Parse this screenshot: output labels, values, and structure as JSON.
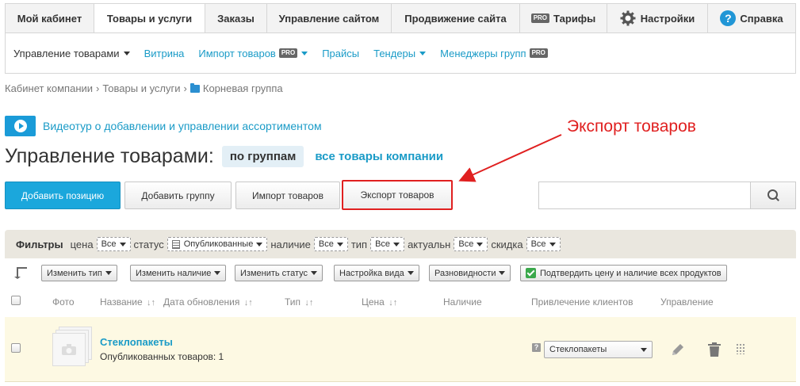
{
  "tabs": [
    {
      "label": "Мой кабинет"
    },
    {
      "label": "Товары и услуги"
    },
    {
      "label": "Заказы"
    },
    {
      "label": "Управление сайтом"
    },
    {
      "label": "Продвижение сайта"
    },
    {
      "label": "Тарифы",
      "badge": "PRO"
    },
    {
      "label": "Настройки",
      "icon": "gear-icon"
    },
    {
      "label": "Справка",
      "icon": "help-icon"
    }
  ],
  "active_tab": "Товары и услуги",
  "submenu": {
    "items": [
      {
        "label": "Управление товарами"
      },
      {
        "label": "Витрина"
      },
      {
        "label": "Импорт товаров",
        "badge": "PRO"
      },
      {
        "label": "Прайсы"
      },
      {
        "label": "Тендеры"
      },
      {
        "label": "Менеджеры групп",
        "badge": "PRO"
      }
    ]
  },
  "breadcrumb": {
    "items": [
      "Кабинет компании",
      "Товары и услуги",
      "Корневая группа"
    ],
    "separator": "›"
  },
  "video": {
    "label": "Видеотур о добавлении и управлении ассортиментом",
    "icon": "play-icon"
  },
  "annotation": {
    "text": "Экспорт товаров",
    "color": "#e02020"
  },
  "title": {
    "text": "Управление товарами:",
    "view_active": "по группам",
    "view_link": "все товары компании"
  },
  "buttons": {
    "add_position": "Добавить позицию",
    "add_group": "Добавить группу",
    "import": "Импорт товаров",
    "export": "Экспорт товаров"
  },
  "search": {
    "placeholder": "",
    "icon": "search-icon"
  },
  "filters": {
    "label": "Фильтры",
    "items": [
      {
        "name": "цена",
        "value": "Все"
      },
      {
        "name": "статус",
        "value": "Опубликованные"
      },
      {
        "name": "наличие",
        "value": "Все"
      },
      {
        "name": "тип",
        "value": "Все"
      },
      {
        "name": "актуальн",
        "value": "Все"
      },
      {
        "name": "скидка",
        "value": "Все"
      }
    ]
  },
  "actions": {
    "change_type": "Изменить тип",
    "change_availability": "Изменить наличие",
    "change_status": "Изменить статус",
    "view_settings": "Настройка вида",
    "variants": "Разновидности",
    "confirm_all": "Подтвердить цену и наличие всех продуктов"
  },
  "columns": {
    "photo": "Фото",
    "name": "Название",
    "updated": "Дата обновления",
    "type": "Тип",
    "price": "Цена",
    "availability": "Наличие",
    "clients": "Привлечение клиентов",
    "manage": "Управление",
    "sort_glyph": "↓↑"
  },
  "rows": [
    {
      "title": "Стеклопакеты",
      "subtitle": "Опубликованных товаров: 1",
      "help": "?",
      "select_value": "Стеклопакеты"
    }
  ],
  "colors": {
    "accent": "#1a9bc7",
    "primary_button": "#1ba7dc",
    "row_highlight": "#fdf9e3",
    "annotation": "#e02020"
  }
}
